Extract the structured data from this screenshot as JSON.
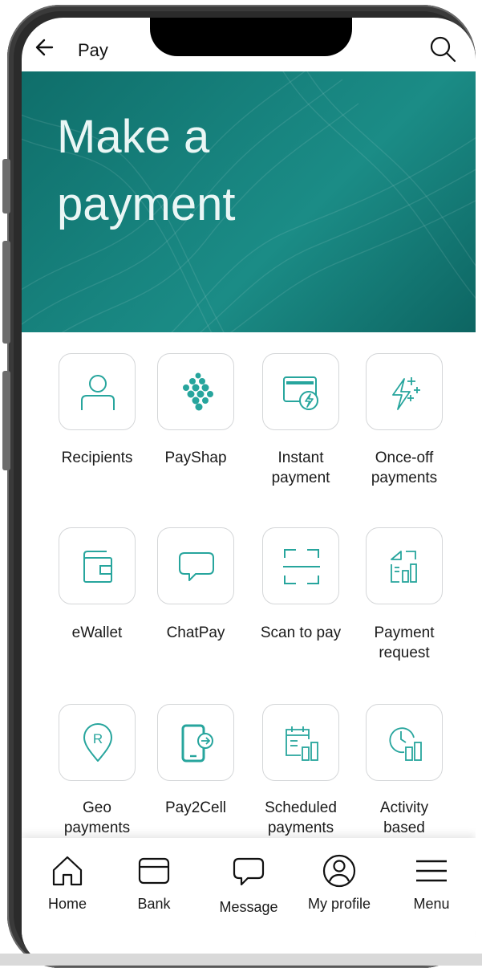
{
  "header": {
    "title": "Pay",
    "back_icon": "back-arrow-icon",
    "search_icon": "search-icon"
  },
  "hero": {
    "line1": "Make a",
    "line2": "payment"
  },
  "colors": {
    "accent": "#27a59d",
    "hero": "#178682",
    "tile_border": "#d4d6d8"
  },
  "grid": {
    "items": [
      {
        "label_line1": "Recipients",
        "label_line2": "",
        "icon": "person-icon"
      },
      {
        "label_line1": "PayShap",
        "label_line2": "",
        "icon": "payshap-dots-icon"
      },
      {
        "label_line1": "Instant",
        "label_line2": "payment",
        "icon": "instant-card-bolt-icon"
      },
      {
        "label_line1": "Once-off",
        "label_line2": "payments",
        "icon": "bolt-sparkle-icon"
      },
      {
        "label_line1": "eWallet",
        "label_line2": "",
        "icon": "wallet-icon"
      },
      {
        "label_line1": "ChatPay",
        "label_line2": "",
        "icon": "chat-bubble-icon"
      },
      {
        "label_line1": "Scan to pay",
        "label_line2": "",
        "icon": "scan-frame-icon"
      },
      {
        "label_line1": "Payment",
        "label_line2": "request",
        "icon": "payment-request-icon"
      },
      {
        "label_line1": "Geo",
        "label_line2": "payments",
        "icon": "location-pin-icon"
      },
      {
        "label_line1": "Pay2Cell",
        "label_line2": "",
        "icon": "phone-arrow-icon"
      },
      {
        "label_line1": "Scheduled",
        "label_line2": "payments",
        "icon": "calendar-bars-icon"
      },
      {
        "label_line1": "Activity",
        "label_line2": "based",
        "icon": "clock-bars-icon"
      }
    ]
  },
  "bottom_nav": {
    "items": [
      {
        "label": "Home",
        "icon": "home-icon"
      },
      {
        "label": "Bank",
        "icon": "card-icon"
      },
      {
        "label": "Message",
        "icon": "message-icon"
      },
      {
        "label": "My profile",
        "icon": "profile-icon"
      },
      {
        "label": "Menu",
        "icon": "hamburger-menu-icon"
      }
    ]
  }
}
